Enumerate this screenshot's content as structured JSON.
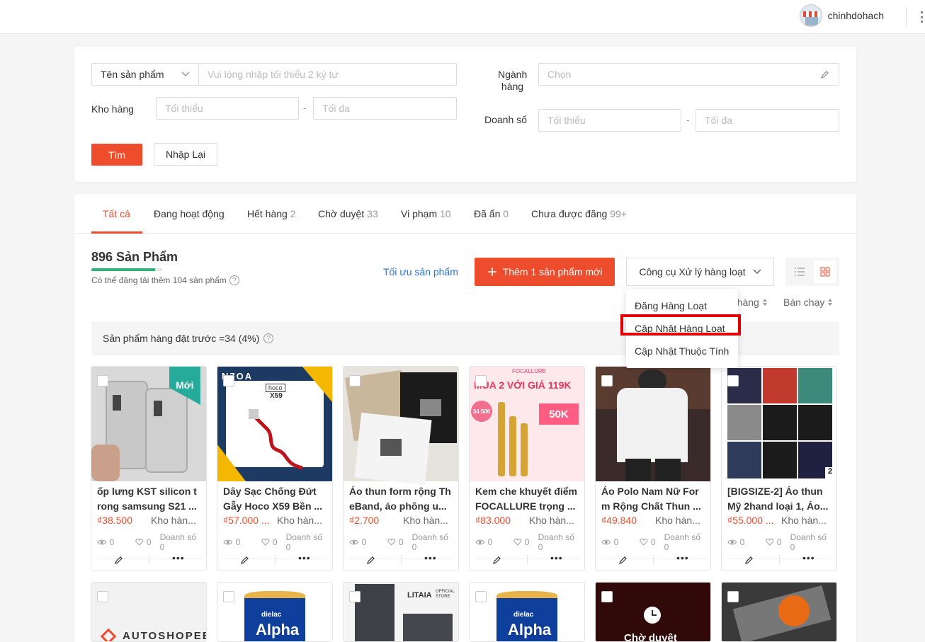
{
  "header": {
    "username": "chinhdohach"
  },
  "filters": {
    "field_select": "Tên sản phẩm",
    "search_placeholder": "Vui lòng nhập tối thiểu 2 ký tự",
    "category_label_1": "Ngành",
    "category_label_2": "hàng",
    "category_placeholder": "Chọn",
    "stock_label": "Kho hàng",
    "stock_min": "Tối thiểu",
    "stock_max": "Tối đa",
    "sales_label": "Doanh số",
    "sales_min": "Tối thiểu",
    "sales_max": "Tối đa",
    "dash": "-",
    "search_button": "Tìm",
    "reset_button": "Nhập Lại"
  },
  "tabs": [
    {
      "label": "Tất cả",
      "count": ""
    },
    {
      "label": "Đang hoạt động",
      "count": ""
    },
    {
      "label": "Hết hàng",
      "count": "2"
    },
    {
      "label": "Chờ duyệt",
      "count": "33"
    },
    {
      "label": "Vi phạm",
      "count": "10"
    },
    {
      "label": "Đã ẩn",
      "count": "0"
    },
    {
      "label": "Chưa được đăng",
      "count": "99+"
    }
  ],
  "summary": {
    "title": "896 Sản Phẩm",
    "note": "Có thể đăng tải thêm 104 sản phẩm",
    "progress": 0.9,
    "optimize_link": "Tối ưu sản phẩm",
    "add_button": "Thêm 1 sản phẩm mới",
    "tools_button": "Công cụ Xử lý hàng loạt"
  },
  "sort": {
    "stock": "o hàng",
    "sold": "Bán chạy"
  },
  "preorder_note": "Sản phẩm hàng đặt trước =34 (4%)",
  "dropdown": {
    "items": [
      "Đăng Hàng Loạt",
      "Cập Nhật Hàng Loạt",
      "Cập Nhật Thuộc Tính"
    ],
    "highlighted_index": 1
  },
  "products": [
    {
      "line1": "ốp lưng KST silicon t",
      "line2": "rong samsung S21 ...",
      "price": "₫38.500",
      "stock": "Kho hàn...",
      "views": "0",
      "likes": "0",
      "sales": "Doanh số 0",
      "badge": "Mới"
    },
    {
      "line1": "Dây Sạc Chống Đứt",
      "line2": "Gẫy Hoco X59 Bền ...",
      "price": "₫57.000 ...",
      "stock": "Kho hàn...",
      "views": "0",
      "likes": "0",
      "sales": "Doanh số 0",
      "brand": "hoco",
      "model": "X59",
      "logo": "N7OA"
    },
    {
      "line1": "Áo thun form rộng Th",
      "line2": "eBand, áo phông u...",
      "price": "₫2.700",
      "stock": "Kho hàn...",
      "views": "0",
      "likes": "0",
      "sales": "Doanh số 0"
    },
    {
      "line1": "Kem che khuyết điểm",
      "line2": "FOCALLURE trọng ...",
      "price": "₫83.000",
      "stock": "Kho hàn...",
      "views": "0",
      "likes": "0",
      "sales": "Doanh số 0",
      "promo": "MUA 2 VỚI GIÁ 119K",
      "voucher": "50K",
      "price_tag": "34.500",
      "brand": "FOCALLURE"
    },
    {
      "line1": "Áo Polo Nam Nữ For",
      "line2": "m Rộng Chất Thun ...",
      "price": "₫49.840",
      "stock": "Kho hàn...",
      "views": "0",
      "likes": "0",
      "sales": "Doanh số 0"
    },
    {
      "line1": "[BIGSIZE-2] Áo thun",
      "line2": "Mỹ 2hand loại 1, Áo...",
      "price": "₫55.000 ...",
      "stock": "Kho hàn...",
      "views": "0",
      "likes": "0",
      "sales": "Doanh số 0",
      "corner_number": "2"
    }
  ],
  "row2": {
    "autoshopee": "AUTOSHOPEE",
    "dielac": "dielac",
    "alpha": "Alpha",
    "litaia": "LITAIA",
    "official": "OFFICIAL STORE",
    "pending": "Chờ duyệt"
  },
  "colors": {
    "accent": "#ee4d2d",
    "link": "#2673dd",
    "highlight": "#e00000",
    "progress": "#2bb673"
  }
}
